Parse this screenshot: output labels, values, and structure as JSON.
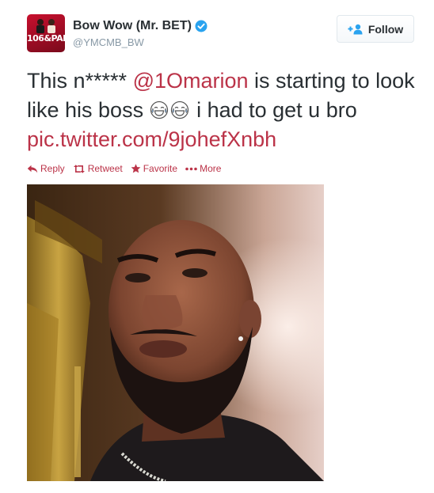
{
  "user": {
    "display_name": "Bow Wow (Mr. BET)",
    "handle": "@YMCMB_BW",
    "avatar_text": "106&PARK"
  },
  "follow_button": {
    "label": "Follow"
  },
  "tweet": {
    "text_before": "This n***** ",
    "mention": "@1Omarion",
    "text_middle": " is starting to look like his boss ",
    "emojis": [
      "face-with-tears-of-joy",
      "face-with-tears-of-joy"
    ],
    "text_after": " i had to get u bro ",
    "media_link": "pic.twitter.com/9johefXnbh"
  },
  "actions": [
    {
      "label": "Reply",
      "icon": "reply-icon"
    },
    {
      "label": "Retweet",
      "icon": "retweet-icon"
    },
    {
      "label": "Favorite",
      "icon": "star-icon"
    },
    {
      "label": "More",
      "icon": "more-dots-icon"
    }
  ],
  "colors": {
    "link": "#bb3348",
    "text": "#292f33",
    "muted": "#8899a6",
    "verified": "#2aa3ef"
  }
}
